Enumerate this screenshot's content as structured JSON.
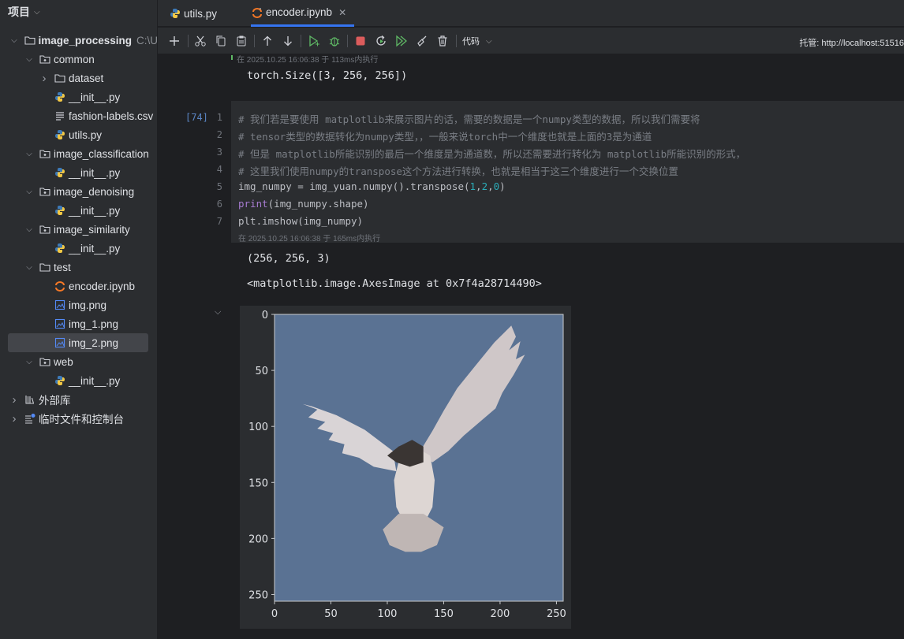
{
  "sidebar": {
    "title": "项目",
    "tree": [
      {
        "label": "image_processing",
        "extra": "C:\\U",
        "icon": "folder-outline-icon",
        "arrow": "down",
        "bold": true
      },
      {
        "label": "common",
        "icon": "package-folder-icon",
        "arrow": "down"
      },
      {
        "label": "dataset",
        "icon": "folder-outline-icon",
        "arrow": "right"
      },
      {
        "label": "__init__.py",
        "icon": "python-file-icon"
      },
      {
        "label": "fashion-labels.csv",
        "icon": "text-file-icon"
      },
      {
        "label": "utils.py",
        "icon": "python-file-icon"
      },
      {
        "label": "image_classification",
        "icon": "package-folder-icon",
        "arrow": "down"
      },
      {
        "label": "__init__.py",
        "icon": "python-file-icon"
      },
      {
        "label": "image_denoising",
        "icon": "package-folder-icon",
        "arrow": "down"
      },
      {
        "label": "__init__.py",
        "icon": "python-file-icon"
      },
      {
        "label": "image_similarity",
        "icon": "package-folder-icon",
        "arrow": "down"
      },
      {
        "label": "__init__.py",
        "icon": "python-file-icon"
      },
      {
        "label": "test",
        "icon": "folder-outline-icon",
        "arrow": "down"
      },
      {
        "label": "encoder.ipynb",
        "icon": "jupyter-notebook-icon"
      },
      {
        "label": "img.png",
        "icon": "image-file-icon"
      },
      {
        "label": "img_1.png",
        "icon": "image-file-icon"
      },
      {
        "label": "img_2.png",
        "icon": "image-file-icon",
        "selected": true
      },
      {
        "label": "web",
        "icon": "package-folder-icon",
        "arrow": "down"
      },
      {
        "label": "__init__.py",
        "icon": "python-file-icon"
      },
      {
        "label": "外部库",
        "icon": "library-icon",
        "arrow": "right"
      },
      {
        "label": "临时文件和控制台",
        "icon": "scratches-icon",
        "arrow": "right"
      }
    ]
  },
  "tabs": [
    {
      "label": "utils.py",
      "icon": "python-file-icon"
    },
    {
      "label": "encoder.ipynb",
      "icon": "jupyter-notebook-icon",
      "active": true
    }
  ],
  "toolbar": {
    "buttons": [
      "add-cell",
      "cut",
      "copy",
      "paste",
      "move-up",
      "move-down",
      "run-cell",
      "debug-cell",
      "stop",
      "restart-kernel",
      "run-all",
      "clear-outputs",
      "delete-cell"
    ],
    "cell_type": "代码",
    "host": "托管: http://localhost:51516"
  },
  "notebook": {
    "prev_exec_info": "在 2025.10.25 16:06:38 于 113ms内执行",
    "prev_output": "torch.Size([3, 256, 256])",
    "cell": {
      "exec_count": "[74]",
      "line_numbers": [
        "1",
        "2",
        "3",
        "4",
        "5",
        "6",
        "7"
      ],
      "comments": [
        "# 我们若是要使用 matplotlib来展示图片的话，需要的数据是一个numpy类型的数据，所以我们需要将",
        "# tensor类型的数据转化为numpy类型，，一般来说torch中一个维度也就是上面的3是为通道",
        "# 但是 matplotlib所能识别的最后一个维度是为通道数，所以还需要进行转化为 matplotlib所能识别的形式，",
        "# 这里我们使用numpy的transpose这个方法进行转换，也就是相当于这三个维度进行一个交换位置"
      ],
      "line5": {
        "code": "img_numpy = img_yuan.numpy().transpose(",
        "n1": "1",
        "c1": ",",
        "n2": "2",
        "c2": ",",
        "n3": "0",
        "end": ")"
      },
      "line6": {
        "kw": "print",
        "rest": "(img_numpy.shape)"
      },
      "line7": "plt.imshow(img_numpy)",
      "exec_info": "在 2025.10.25 16:06:38 于 165ms内执行"
    },
    "outputs": {
      "shape": "(256, 256, 3)",
      "repr": "<matplotlib.image.AxesImage at 0x7f4a28714490>"
    }
  },
  "chart_data": {
    "type": "image",
    "xlim": [
      0,
      256
    ],
    "ylim": [
      256,
      0
    ],
    "xticks": [
      0,
      50,
      100,
      150,
      200,
      250
    ],
    "yticks": [
      0,
      50,
      100,
      150,
      200,
      250
    ],
    "xtick_labels": [
      "0",
      "50",
      "100",
      "150",
      "200",
      "250"
    ],
    "ytick_labels": [
      "0",
      "50",
      "100",
      "150",
      "200",
      "250"
    ],
    "image_background": "#5a7293",
    "image_subject": "eagle with spread wings"
  },
  "colors": {
    "accent": "#3574f0",
    "sidebar_bg": "#2b2d30",
    "editor_bg": "#1e1f22",
    "comment": "#7a7e85",
    "keyword": "#a77bd1",
    "number": "#2aacb8"
  }
}
